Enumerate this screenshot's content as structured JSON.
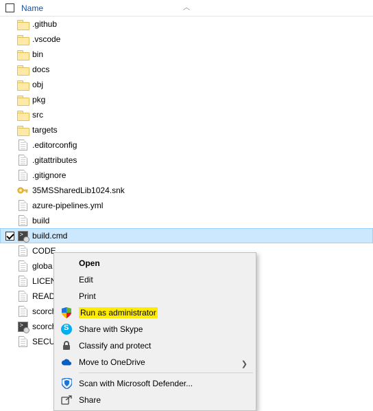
{
  "header": {
    "column_name": "Name"
  },
  "files": [
    {
      "name": ".github",
      "type": "folder"
    },
    {
      "name": ".vscode",
      "type": "folder"
    },
    {
      "name": "bin",
      "type": "folder"
    },
    {
      "name": "docs",
      "type": "folder"
    },
    {
      "name": "obj",
      "type": "folder"
    },
    {
      "name": "pkg",
      "type": "folder"
    },
    {
      "name": "src",
      "type": "folder"
    },
    {
      "name": "targets",
      "type": "folder"
    },
    {
      "name": ".editorconfig",
      "type": "file"
    },
    {
      "name": ".gitattributes",
      "type": "file"
    },
    {
      "name": ".gitignore",
      "type": "file"
    },
    {
      "name": "35MSSharedLib1024.snk",
      "type": "key"
    },
    {
      "name": "azure-pipelines.yml",
      "type": "file"
    },
    {
      "name": "build",
      "type": "file"
    },
    {
      "name": "build.cmd",
      "type": "cmd",
      "selected": true,
      "checked": true
    },
    {
      "name": "CODE",
      "type": "file"
    },
    {
      "name": "globa",
      "type": "file"
    },
    {
      "name": "LICEN",
      "type": "file"
    },
    {
      "name": "READ",
      "type": "file"
    },
    {
      "name": "scorch",
      "type": "file"
    },
    {
      "name": "scorch",
      "type": "cmd"
    },
    {
      "name": "SECUI",
      "type": "file"
    }
  ],
  "menu": {
    "open": "Open",
    "edit": "Edit",
    "print": "Print",
    "run_admin": "Run as administrator",
    "share_skype": "Share with Skype",
    "classify": "Classify and protect",
    "onedrive": "Move to OneDrive",
    "defender": "Scan with Microsoft Defender...",
    "share": "Share"
  }
}
